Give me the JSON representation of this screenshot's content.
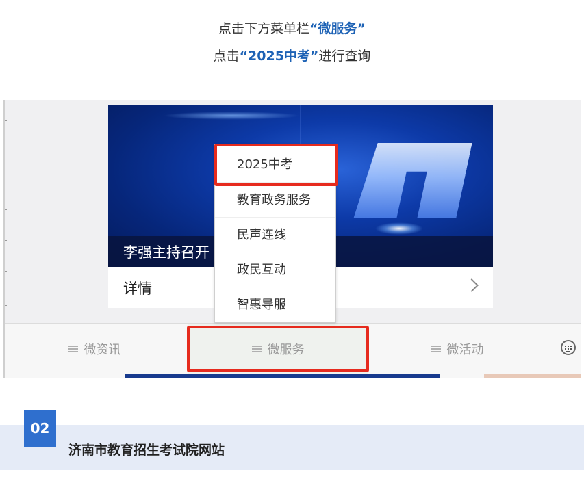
{
  "instructions": {
    "line1_prefix": "点击下方菜单栏",
    "line1_highlight": "“微服务”",
    "line2_prefix": "点击",
    "line2_highlight": "“2025中考”",
    "line2_suffix": "进行查询"
  },
  "banner": {
    "caption": "李强主持召开"
  },
  "detail_row": {
    "label": "详情"
  },
  "popup_menu": {
    "items": [
      {
        "label": "2025中考",
        "highlighted": true
      },
      {
        "label": "教育政务服务"
      },
      {
        "label": "民声连线"
      },
      {
        "label": "政民互动"
      },
      {
        "label": "智惠导服"
      }
    ]
  },
  "bottom_menu": {
    "items": [
      {
        "label": "微资讯"
      },
      {
        "label": "微服务",
        "highlighted": true
      },
      {
        "label": "微活动"
      }
    ],
    "keyboard_icon": "keyboard-icon"
  },
  "section": {
    "number": "02",
    "title": "济南市教育招生考试院网站"
  },
  "colors": {
    "accent_blue": "#1d62b5",
    "highlight_red": "#e62b1e",
    "section_badge": "#2f6fce",
    "section_band": "#e5ebf7"
  }
}
